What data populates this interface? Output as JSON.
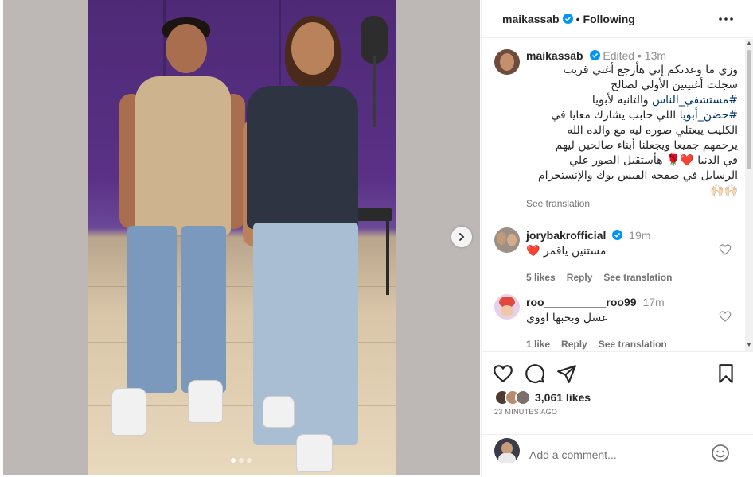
{
  "header": {
    "username": "maikassab",
    "separator": "•",
    "follow_state": "Following"
  },
  "caption": {
    "username": "maikassab",
    "edited": "Edited",
    "dot": "•",
    "time": "13m",
    "line1": "وزي ما وعدتكم إني هأرجع أغني قريب",
    "line2": "سجلت أغنيتين الأولي لصالح",
    "line3_tag": "#مستشفي_الناس",
    "line3_text": " والتانيه لأبويا",
    "line4_tag": "#حضن_أبويا",
    "line4_text": " اللي حابب يشارك معايا في",
    "line5": "الكليب يبعتلي صوره ليه مع والده الله",
    "line6": "يرحمهم جميعا ويجعلنا أبناء صالحين ليهم",
    "line7": "في الدنيا ❤️🌹 هأستقبل الصور علي",
    "line8": "الرسايل في صفحه الفيس بوك والإنستجرام",
    "line9": "🙌🏻🙌🏻",
    "see_translation": "See translation"
  },
  "comments": [
    {
      "username": "jorybakrofficial",
      "time": "19m",
      "text": "مستنين ياقمر ❤️",
      "likes": "5 likes",
      "reply": "Reply",
      "see_translation": "See translation"
    },
    {
      "username": "roo__________roo99",
      "time": "17m",
      "text": "عسل وبحبها اووي",
      "likes": "1 like",
      "reply": "Reply",
      "see_translation": "See translation"
    }
  ],
  "likes": {
    "text": "3,061 likes",
    "time_ago": "23 MINUTES AGO"
  },
  "add_comment": {
    "placeholder": "Add a comment..."
  },
  "media": {
    "slide_index": 1,
    "slide_count": 3
  },
  "colors": {
    "verified": "#0095f6",
    "hashtag": "#00376b",
    "heart": "#ed4956",
    "secondary_text": "#737373"
  }
}
